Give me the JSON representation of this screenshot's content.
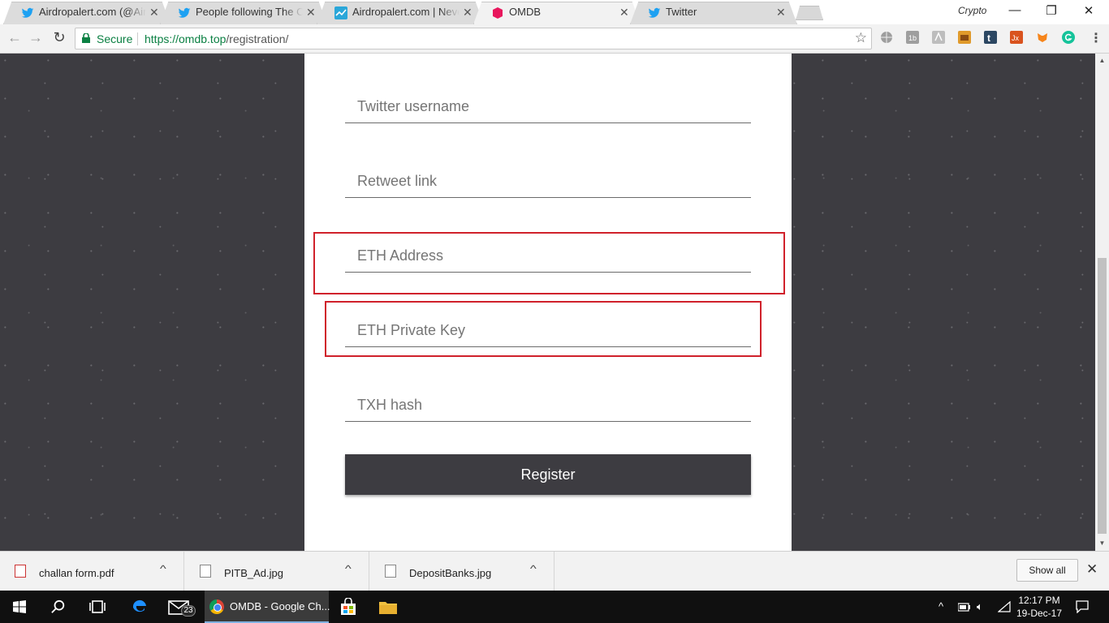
{
  "browser": {
    "tabs": [
      {
        "title": "Airdropalert.com (@Aird",
        "icon": "twitter-icon",
        "active": false
      },
      {
        "title": "People following The Cry",
        "icon": "twitter-icon",
        "active": false
      },
      {
        "title": "Airdropalert.com | Never",
        "icon": "airdropalert-icon",
        "active": false
      },
      {
        "title": "OMDB",
        "icon": "omdb-icon",
        "active": true
      },
      {
        "title": "Twitter",
        "icon": "twitter-icon",
        "active": false
      }
    ],
    "profile_name": "Crypto",
    "window_controls": {
      "minimize": "—",
      "restore": "❐",
      "close": "✕"
    },
    "secure_label": "Secure",
    "url_host": "https://omdb.top",
    "url_path": "/registration/",
    "extensions": [
      "globe-icon",
      "1b-icon",
      "pdf-ext-icon",
      "box-icon",
      "tumblr-icon",
      "jx-icon",
      "metamask-icon",
      "grammarly-icon"
    ]
  },
  "form": {
    "fields": {
      "twitter": {
        "placeholder": "Twitter username"
      },
      "retweet": {
        "placeholder": "Retweet link"
      },
      "eth_address": {
        "placeholder": "ETH Address"
      },
      "eth_private_key": {
        "placeholder": "ETH Private Key"
      },
      "txh_hash": {
        "placeholder": "TXH hash"
      }
    },
    "register_label": "Register",
    "highlight_color": "#d0212b",
    "button_color": "#3d3c41"
  },
  "downloads": {
    "items": [
      {
        "name": "challan form.pdf",
        "icon": "pdf-file-icon"
      },
      {
        "name": "PITB_Ad.jpg",
        "icon": "image-file-icon"
      },
      {
        "name": "DepositBanks.jpg",
        "icon": "image-file-icon"
      }
    ],
    "show_all_label": "Show all"
  },
  "taskbar": {
    "active_app_label": "OMDB - Google Ch...",
    "mail_badge": "23",
    "time": "12:17 PM",
    "date": "19-Dec-17"
  }
}
